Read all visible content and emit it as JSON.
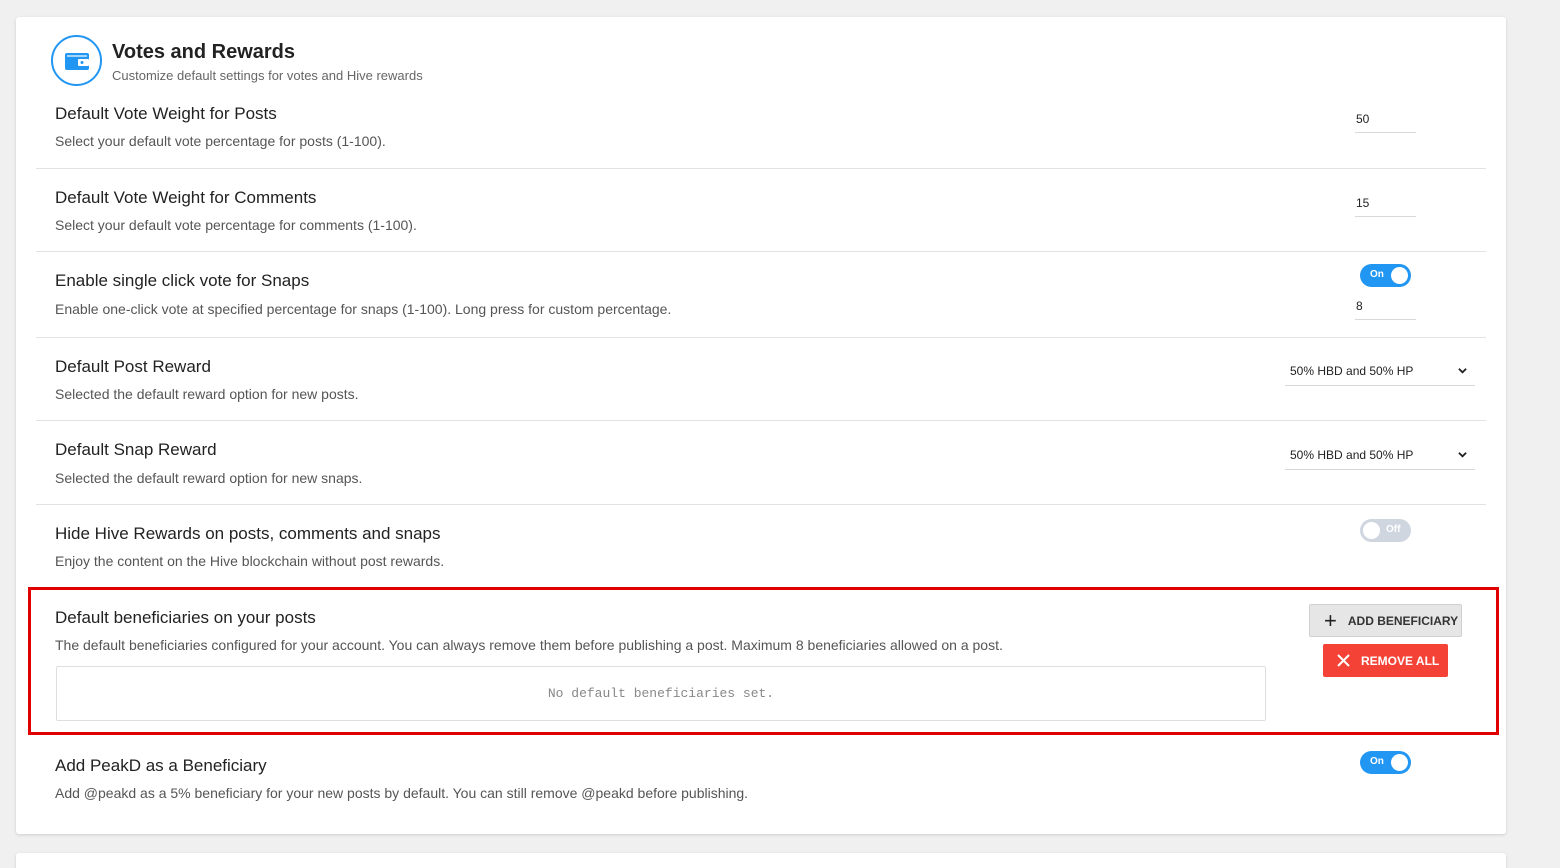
{
  "header": {
    "icon": "wallet-icon",
    "title": "Votes and Rewards",
    "subtitle": "Customize default settings for votes and Hive rewards"
  },
  "settings": {
    "vote_posts": {
      "title": "Default Vote Weight for Posts",
      "desc": "Select your default vote percentage for posts (1-100).",
      "value": "50"
    },
    "vote_comments": {
      "title": "Default Vote Weight for Comments",
      "desc": "Select your default vote percentage for comments (1-100).",
      "value": "15"
    },
    "snap_vote": {
      "title": "Enable single click vote for Snaps",
      "desc": "Enable one-click vote at specified percentage for snaps (1-100). Long press for custom percentage.",
      "toggle": "On",
      "value": "8"
    },
    "post_reward": {
      "title": "Default Post Reward",
      "desc": "Selected the default reward option for new posts.",
      "selected": "50% HBD and 50% HP"
    },
    "snap_reward": {
      "title": "Default Snap Reward",
      "desc": "Selected the default reward option for new snaps.",
      "selected": "50% HBD and 50% HP"
    },
    "hide_rewards": {
      "title": "Hide Hive Rewards on posts, comments and snaps",
      "desc": "Enjoy the content on the Hive blockchain without post rewards.",
      "toggle": "Off"
    },
    "beneficiaries": {
      "title": "Default beneficiaries on your posts",
      "desc": "The default beneficiaries configured for your account. You can always remove them before publishing a post. Maximum 8 beneficiaries allowed on a post.",
      "add_label": "ADD BENEFICIARY",
      "remove_label": "REMOVE ALL",
      "empty_text": "No default beneficiaries set."
    },
    "peakd_beneficiary": {
      "title": "Add PeakD as a Beneficiary",
      "desc": "Add @peakd as a 5% beneficiary for your new posts by default. You can still remove @peakd before publishing.",
      "toggle": "On"
    }
  },
  "colors": {
    "accent": "#2196f3",
    "danger": "#f44336",
    "highlight": "#e00000"
  }
}
